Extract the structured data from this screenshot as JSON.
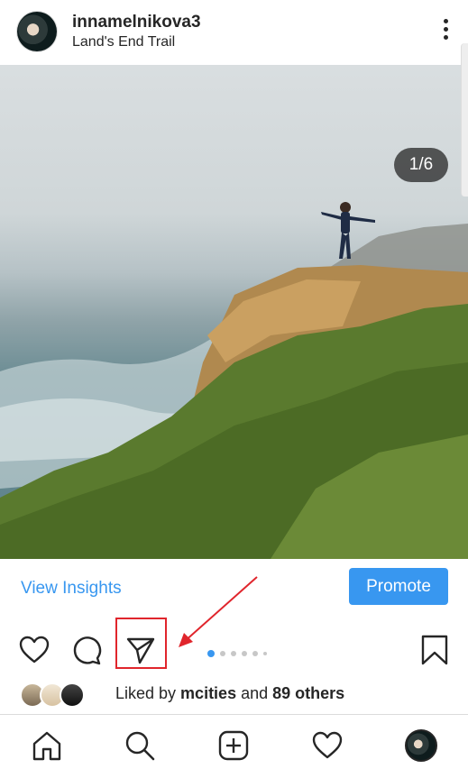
{
  "post": {
    "username": "innamelnikova3",
    "location": "Land's End Trail",
    "image_counter": "1/6"
  },
  "insights": {
    "view_insights_label": "View Insights",
    "promote_label": "Promote"
  },
  "actions": {
    "icons": [
      "heart-icon",
      "comment-icon",
      "share-icon",
      "bookmark-icon"
    ],
    "carousel": {
      "current": 1,
      "total": 6
    },
    "highlight_color": "#e0252c"
  },
  "likes": {
    "prefix": "Liked by ",
    "user": "mcities",
    "middle": " and ",
    "others": "89 others"
  },
  "bottom_nav": {
    "items": [
      "home-icon",
      "search-icon",
      "add-post-icon",
      "activity-heart-icon",
      "profile-avatar"
    ]
  },
  "colors": {
    "accent_blue": "#3897f0",
    "text": "#262626"
  }
}
